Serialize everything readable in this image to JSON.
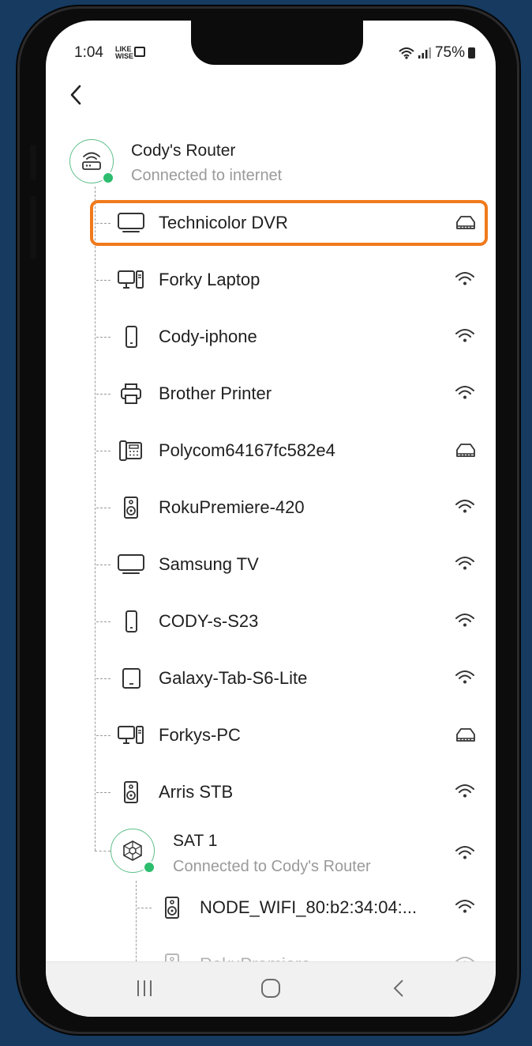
{
  "status_bar": {
    "time": "1:04",
    "tag": "LIKE WISE",
    "battery": "75%"
  },
  "router": {
    "name": "Cody's Router",
    "status": "Connected to internet",
    "icon": "router-icon"
  },
  "devices": [
    {
      "name": "Technicolor DVR",
      "device_icon": "tv-icon",
      "connection": "ethernet"
    },
    {
      "name": "Forky Laptop",
      "device_icon": "computer-icon",
      "connection": "wifi"
    },
    {
      "name": "Cody-iphone",
      "device_icon": "phone-icon",
      "connection": "wifi"
    },
    {
      "name": "Brother Printer",
      "device_icon": "printer-icon",
      "connection": "wifi"
    },
    {
      "name": "Polycom64167fc582e4",
      "device_icon": "desk-phone-icon",
      "connection": "ethernet"
    },
    {
      "name": "RokuPremiere-420",
      "device_icon": "speaker-icon",
      "connection": "wifi"
    },
    {
      "name": "Samsung TV",
      "device_icon": "tv-icon",
      "connection": "wifi"
    },
    {
      "name": "CODY-s-S23",
      "device_icon": "phone-icon",
      "connection": "wifi"
    },
    {
      "name": "Galaxy-Tab-S6-Lite",
      "device_icon": "tablet-icon",
      "connection": "wifi"
    },
    {
      "name": "Forkys-PC",
      "device_icon": "computer-icon",
      "connection": "ethernet"
    },
    {
      "name": "Arris STB",
      "device_icon": "speaker-icon",
      "connection": "wifi"
    }
  ],
  "satellite": {
    "name": "SAT 1",
    "status": "Connected to Cody's Router",
    "icon": "mesh-node-icon",
    "connection": "wifi",
    "devices": [
      {
        "name": "NODE_WIFI_80:b2:34:04:...",
        "device_icon": "speaker-icon",
        "connection": "wifi"
      },
      {
        "name": "RokuPremiere",
        "device_icon": "speaker-icon",
        "connection": "wifi"
      }
    ]
  },
  "colors": {
    "accent_highlight": "#f07a1c",
    "online_dot": "#2dbd6e",
    "hub_ring": "#5fbf8a",
    "background": "#163a60"
  }
}
